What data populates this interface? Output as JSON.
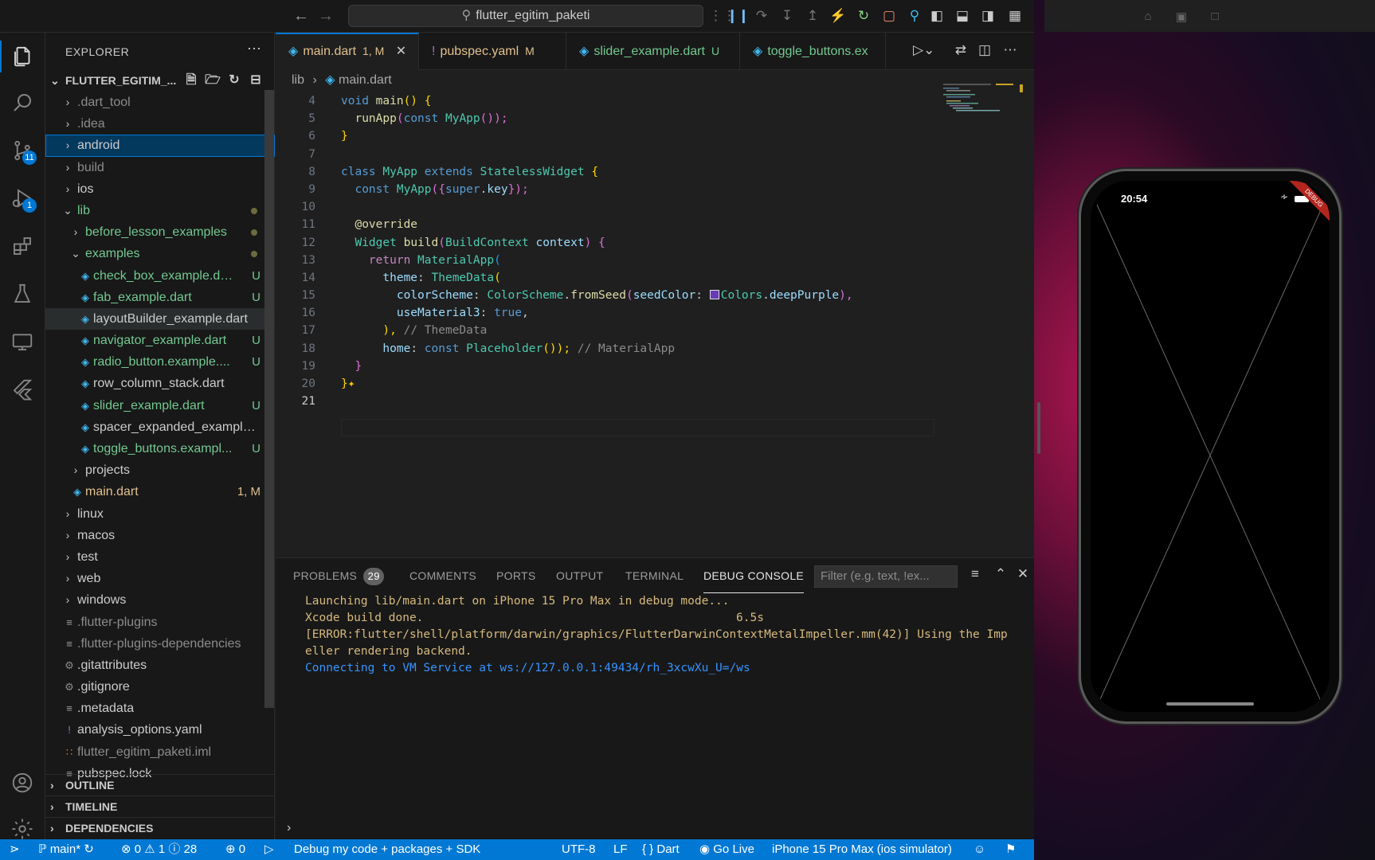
{
  "titlebar": {
    "search": "flutter_egitim_paketi"
  },
  "activity": {
    "scm_badge": "11",
    "debug_badge": "1"
  },
  "sidebar": {
    "title": "EXPLORER",
    "project": "FLUTTER_EGITIM_...",
    "tree": [
      {
        "label": ".dart_tool",
        "depth": 0,
        "kind": "folder",
        "open": false,
        "dim": true
      },
      {
        "label": ".idea",
        "depth": 0,
        "kind": "folder",
        "open": false,
        "dim": true
      },
      {
        "label": "android",
        "depth": 0,
        "kind": "folder",
        "open": false,
        "state": "selected"
      },
      {
        "label": "build",
        "depth": 0,
        "kind": "folder",
        "open": false,
        "dim": true
      },
      {
        "label": "ios",
        "depth": 0,
        "kind": "folder",
        "open": false
      },
      {
        "label": "lib",
        "depth": 0,
        "kind": "folder",
        "open": true,
        "git": "u",
        "dot": true
      },
      {
        "label": "before_lesson_examples",
        "depth": 1,
        "kind": "folder",
        "open": false,
        "git": "u",
        "dot": true
      },
      {
        "label": "examples",
        "depth": 1,
        "kind": "folder",
        "open": true,
        "git": "u",
        "dot": true
      },
      {
        "label": "check_box_example.dart",
        "depth": 2,
        "kind": "dart",
        "git": "u",
        "badge": "U"
      },
      {
        "label": "fab_example.dart",
        "depth": 2,
        "kind": "dart",
        "git": "u",
        "badge": "U"
      },
      {
        "label": "layoutBuilder_example.dart",
        "depth": 2,
        "kind": "dart",
        "state": "hover"
      },
      {
        "label": "navigator_example.dart",
        "depth": 2,
        "kind": "dart",
        "git": "u",
        "badge": "U"
      },
      {
        "label": "radio_button.example....",
        "depth": 2,
        "kind": "dart",
        "git": "u",
        "badge": "U"
      },
      {
        "label": "row_column_stack.dart",
        "depth": 2,
        "kind": "dart"
      },
      {
        "label": "slider_example.dart",
        "depth": 2,
        "kind": "dart",
        "git": "u",
        "badge": "U"
      },
      {
        "label": "spacer_expanded_example....",
        "depth": 2,
        "kind": "dart"
      },
      {
        "label": "toggle_buttons.exampl...",
        "depth": 2,
        "kind": "dart",
        "git": "u",
        "badge": "U"
      },
      {
        "label": "projects",
        "depth": 1,
        "kind": "folder",
        "open": false
      },
      {
        "label": "main.dart",
        "depth": 1,
        "kind": "dart",
        "git": "m",
        "badge": "1, M"
      },
      {
        "label": "linux",
        "depth": 0,
        "kind": "folder",
        "open": false
      },
      {
        "label": "macos",
        "depth": 0,
        "kind": "folder",
        "open": false
      },
      {
        "label": "test",
        "depth": 0,
        "kind": "folder",
        "open": false
      },
      {
        "label": "web",
        "depth": 0,
        "kind": "folder",
        "open": false
      },
      {
        "label": "windows",
        "depth": 0,
        "kind": "folder",
        "open": false
      },
      {
        "label": ".flutter-plugins",
        "depth": 0,
        "kind": "lines",
        "dim": true
      },
      {
        "label": ".flutter-plugins-dependencies",
        "depth": 0,
        "kind": "lines",
        "dim": true
      },
      {
        "label": ".gitattributes",
        "depth": 0,
        "kind": "gear"
      },
      {
        "label": ".gitignore",
        "depth": 0,
        "kind": "gear"
      },
      {
        "label": ".metadata",
        "depth": 0,
        "kind": "lines"
      },
      {
        "label": "analysis_options.yaml",
        "depth": 0,
        "kind": "yaml"
      },
      {
        "label": "flutter_egitim_paketi.iml",
        "depth": 0,
        "kind": "rss",
        "dim": true
      },
      {
        "label": "pubspec.lock",
        "depth": 0,
        "kind": "lines"
      }
    ],
    "sections": [
      "OUTLINE",
      "TIMELINE",
      "DEPENDENCIES"
    ]
  },
  "tabs": [
    {
      "label": "main.dart",
      "status": "1, M",
      "active": true
    },
    {
      "label": "pubspec.yaml",
      "status": "M"
    },
    {
      "label": "slider_example.dart",
      "status": "U"
    },
    {
      "label": "toggle_buttons.ex"
    }
  ],
  "breadcrumb": {
    "folder": "lib",
    "file": "main.dart"
  },
  "code": {
    "line_numbers": [
      "4",
      "5",
      "6",
      "7",
      "8",
      "9",
      "10",
      "11",
      "12",
      "13",
      "14",
      "15",
      "16",
      "17",
      "18",
      "19",
      "20",
      "21"
    ],
    "l4": [
      "void",
      "main",
      "() {"
    ],
    "l5": [
      "runApp",
      "(",
      "const",
      "MyApp",
      "());"
    ],
    "l8": [
      "class",
      "MyApp",
      "extends",
      "StatelessWidget",
      "{"
    ],
    "l9": [
      "const",
      "MyApp",
      "({",
      "super",
      ".",
      "key",
      "});"
    ],
    "l11": "@override",
    "l12": [
      "Widget",
      "build",
      "(",
      "BuildContext",
      "context",
      ") {"
    ],
    "l13": [
      "return",
      "MaterialApp",
      "("
    ],
    "l14": [
      "theme",
      ":",
      "ThemeData",
      "("
    ],
    "l15": [
      "colorScheme",
      ":",
      "ColorScheme",
      ".",
      "fromSeed",
      "(",
      "seedColor",
      ":",
      "Colors",
      ".",
      "deepPurple",
      "),"
    ],
    "l16": [
      "useMaterial3",
      ":",
      "true",
      ","
    ],
    "l17": [
      "),",
      "// ThemeData"
    ],
    "l18": [
      "home",
      ":",
      "const",
      "Placeholder",
      "());",
      "// MaterialApp"
    ]
  },
  "panel": {
    "tabs": [
      "PROBLEMS",
      "COMMENTS",
      "PORTS",
      "OUTPUT",
      "TERMINAL",
      "DEBUG CONSOLE"
    ],
    "problems_count": "29",
    "filter_placeholder": "Filter (e.g. text, !ex...",
    "console": [
      "Launching lib/main.dart on iPhone 15 Pro Max in debug mode...",
      "Xcode build done.",
      "6.5s",
      "[ERROR:flutter/shell/platform/darwin/graphics/FlutterDarwinContextMetalImpeller.mm(42)] Using the Imp",
      "eller rendering backend.",
      "Connecting to VM Service at ws://127.0.0.1:49434/rh_3xcwXu_U=/ws"
    ]
  },
  "status": {
    "branch": "main*",
    "errors": "0",
    "warnings": "1",
    "infos": "28",
    "ports": "0",
    "debug_mode": "Debug my code + packages + SDK",
    "encoding": "UTF-8",
    "eol": "LF",
    "language": "Dart",
    "golive": "Go Live",
    "device": "iPhone 15 Pro Max (ios simulator)"
  },
  "phone": {
    "time": "20:54",
    "ribbon": "DEBUG"
  },
  "colors": {
    "accent": "#0078d4",
    "statusbar": "#0078d4",
    "git_untracked": "#73c991",
    "git_modified": "#e2c08d",
    "seed_swatch": "#673ab7"
  }
}
